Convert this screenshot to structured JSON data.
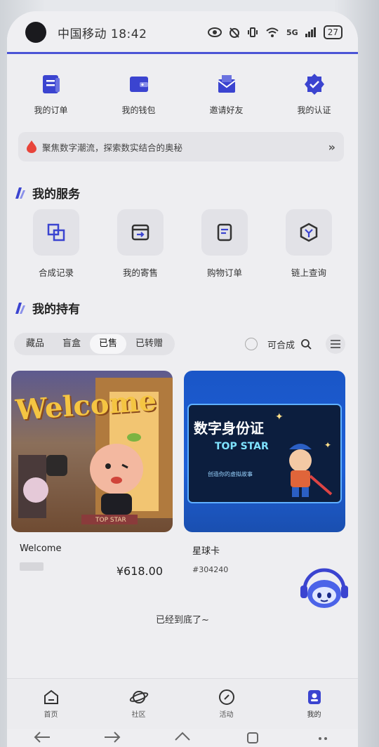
{
  "status": {
    "carrier_time": "中国移动 18:42",
    "battery": "27",
    "signal_label": "5G"
  },
  "quick_actions": [
    {
      "label": "我的订单",
      "icon": "order-icon"
    },
    {
      "label": "我的钱包",
      "icon": "wallet-icon"
    },
    {
      "label": "邀请好友",
      "icon": "invite-icon"
    },
    {
      "label": "我的认证",
      "icon": "verified-icon"
    }
  ],
  "banner": {
    "text": "聚焦数字潮流，探索数实结合的奥秘",
    "more": "»"
  },
  "services": {
    "title": "我的服务",
    "items": [
      {
        "label": "合成记录",
        "icon": "compose-record-icon"
      },
      {
        "label": "我的寄售",
        "icon": "consign-icon"
      },
      {
        "label": "购物订单",
        "icon": "shopping-order-icon"
      },
      {
        "label": "链上查询",
        "icon": "chain-query-icon"
      }
    ]
  },
  "holdings": {
    "title": "我的持有",
    "tabs": [
      "藏品",
      "盲盒",
      "已售",
      "已转赠"
    ],
    "active_tab": "已售",
    "filter_label": "可合成"
  },
  "cards": [
    {
      "name": "Welcome",
      "sub": "",
      "price": "¥618.00",
      "image_text": "Welcome",
      "image_tag": "TOP STAR"
    },
    {
      "name": "星球卡",
      "sub": "#304240",
      "price": "",
      "image_title": "数字身份证",
      "image_sub": "TOP STAR",
      "image_caption": "创造你的虚拟故事"
    }
  ],
  "end_text": "已经到底了~",
  "bottom_nav": [
    {
      "label": "首页",
      "icon": "home-icon"
    },
    {
      "label": "社区",
      "icon": "planet-icon"
    },
    {
      "label": "活动",
      "icon": "compass-icon"
    },
    {
      "label": "我的",
      "icon": "user-icon"
    }
  ],
  "colors": {
    "accent": "#4b54d6",
    "banner_drop": "#e8443a"
  }
}
